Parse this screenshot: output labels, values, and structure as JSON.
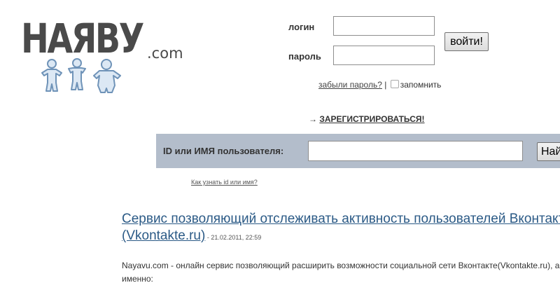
{
  "logo": {
    "brand": "НАЯВУ",
    "suffix": ".com"
  },
  "login": {
    "login_label": "логин",
    "password_label": "пароль",
    "login_value": "",
    "password_value": "",
    "submit_label": "войти!",
    "forgot_link": "забыли пароль?",
    "separator": "|",
    "remember_label": "запомнить",
    "register_arrow": "→",
    "register_link": "ЗАРЕГИСТРИРОВАТЬСЯ!"
  },
  "search": {
    "label": "ID или ИМЯ пользователя:",
    "value": "",
    "button_label": "Найти",
    "help_link": "Как узнать id или имя?"
  },
  "article": {
    "title_line1": "Сервис позволяющий отслеживать активность пользователей Вконтакте",
    "title_line2": "(Vkontakte.ru)",
    "date": " - 21.02.2011, 22:59",
    "body_line1": "Nayavu.com - онлайн сервис позволяющий расширить возможности социальной сети Вконтакте(Vkontakte.ru), а",
    "body_line2": "именно:"
  },
  "colors": {
    "search_bar_bg": "#b3bdcb",
    "title_link": "#2b5a86"
  }
}
